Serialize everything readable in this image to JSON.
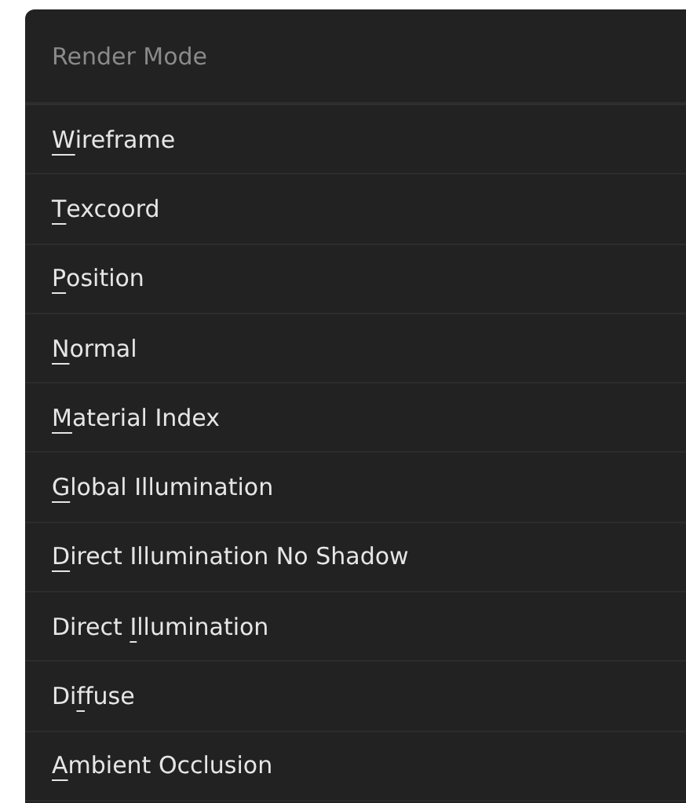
{
  "menu": {
    "title": "Render Mode",
    "items": [
      {
        "key": "W",
        "after": "ireframe"
      },
      {
        "key": "T",
        "after": "excoord"
      },
      {
        "key": "P",
        "after": "osition"
      },
      {
        "key": "N",
        "after": "ormal"
      },
      {
        "key": "M",
        "after": "aterial Index"
      },
      {
        "key": "G",
        "after": "lobal Illumination"
      },
      {
        "key": "D",
        "after": "irect Illumination No Shadow"
      },
      {
        "before": "Direct ",
        "key": "I",
        "after": "llumination"
      },
      {
        "before": "Di",
        "key": "f",
        "after": "fuse"
      },
      {
        "key": "A",
        "after": "mbient Occlusion"
      }
    ]
  }
}
